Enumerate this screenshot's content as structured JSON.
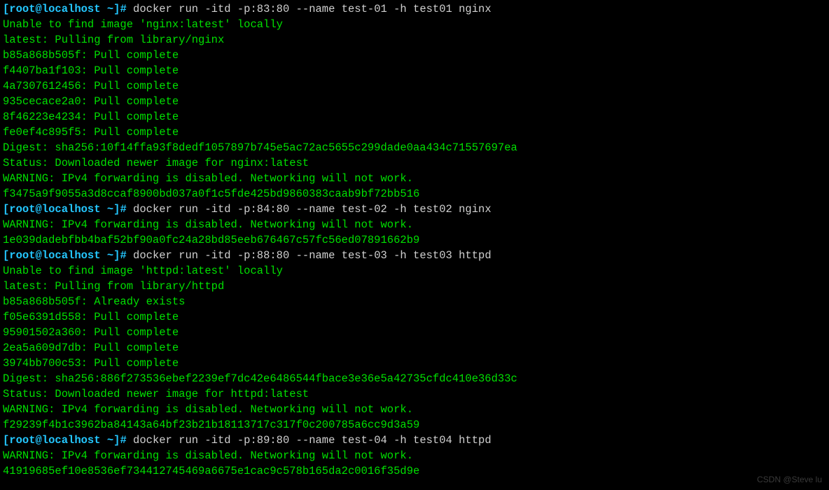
{
  "prompt": "[root@localhost ~]# ",
  "blocks": [
    {
      "cmd": "docker run -itd -p:83:80 --name test-01 -h test01 nginx",
      "out": [
        "Unable to find image 'nginx:latest' locally",
        "latest: Pulling from library/nginx",
        "b85a868b505f: Pull complete",
        "f4407ba1f103: Pull complete",
        "4a7307612456: Pull complete",
        "935cecace2a0: Pull complete",
        "8f46223e4234: Pull complete",
        "fe0ef4c895f5: Pull complete",
        "Digest: sha256:10f14ffa93f8dedf1057897b745e5ac72ac5655c299dade0aa434c71557697ea",
        "Status: Downloaded newer image for nginx:latest",
        "WARNING: IPv4 forwarding is disabled. Networking will not work.",
        "f3475a9f9055a3d8ccaf8900bd037a0f1c5fde425bd9860383caab9bf72bb516"
      ]
    },
    {
      "cmd": "docker run -itd -p:84:80 --name test-02 -h test02 nginx",
      "out": [
        "WARNING: IPv4 forwarding is disabled. Networking will not work.",
        "1e039dadebfbb4baf52bf90a0fc24a28bd85eeb676467c57fc56ed07891662b9"
      ]
    },
    {
      "cmd": "docker run -itd -p:88:80 --name test-03 -h test03 httpd",
      "out": [
        "Unable to find image 'httpd:latest' locally",
        "latest: Pulling from library/httpd",
        "b85a868b505f: Already exists",
        "f05e6391d558: Pull complete",
        "95901502a360: Pull complete",
        "2ea5a609d7db: Pull complete",
        "3974bb700c53: Pull complete",
        "Digest: sha256:886f273536ebef2239ef7dc42e6486544fbace3e36e5a42735cfdc410e36d33c",
        "Status: Downloaded newer image for httpd:latest",
        "WARNING: IPv4 forwarding is disabled. Networking will not work.",
        "f29239f4b1c3962ba84143a64bf23b21b18113717c317f0c200785a6cc9d3a59"
      ]
    },
    {
      "cmd": "docker run -itd -p:89:80 --name test-04 -h test04 httpd",
      "out": [
        "WARNING: IPv4 forwarding is disabled. Networking will not work.",
        "41919685ef10e8536ef734412745469a6675e1cac9c578b165da2c0016f35d9e"
      ]
    }
  ],
  "watermark": "CSDN @Steve lu"
}
